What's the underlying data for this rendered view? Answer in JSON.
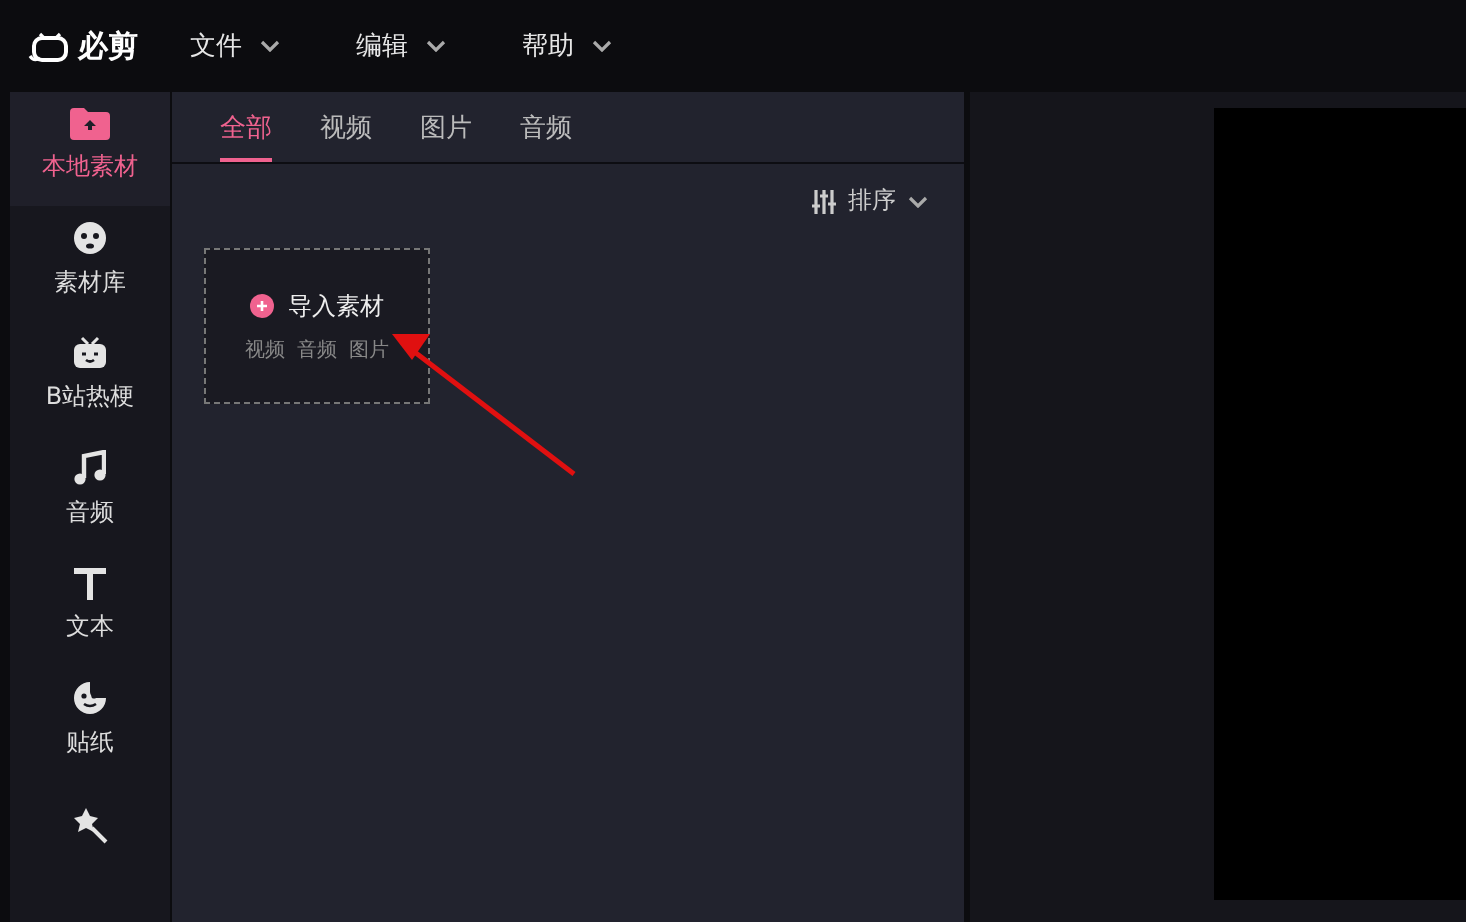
{
  "app": {
    "name": "必剪"
  },
  "menu": [
    {
      "label": "文件"
    },
    {
      "label": "编辑"
    },
    {
      "label": "帮助"
    }
  ],
  "sidebar": {
    "items": [
      {
        "label": "本地素材",
        "selected": true
      },
      {
        "label": "素材库",
        "selected": false
      },
      {
        "label": "B站热梗",
        "selected": false
      },
      {
        "label": "音频",
        "selected": false
      },
      {
        "label": "文本",
        "selected": false
      },
      {
        "label": "贴纸",
        "selected": false
      },
      {
        "selected": false
      }
    ]
  },
  "tabs": [
    {
      "label": "全部",
      "selected": true
    },
    {
      "label": "视频",
      "selected": false
    },
    {
      "label": "图片",
      "selected": false
    },
    {
      "label": "音频",
      "selected": false
    }
  ],
  "sort": {
    "label": "排序"
  },
  "import_card": {
    "title": "导入素材",
    "types": [
      "视频",
      "音频",
      "图片"
    ]
  },
  "annotation": {
    "kind": "arrow"
  }
}
